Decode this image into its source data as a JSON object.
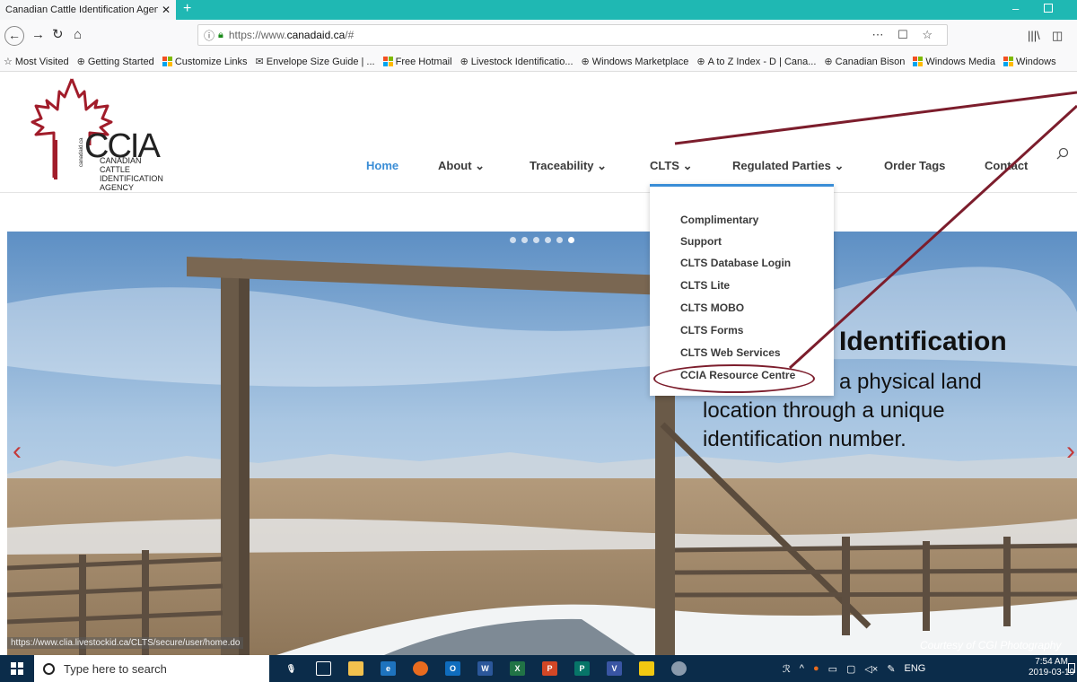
{
  "browser": {
    "tab_title": "Canadian Cattle Identification Agen",
    "url_scheme": "https://www.",
    "url_domain": "canadaid.ca",
    "url_path": "/#",
    "bookmarks": [
      {
        "label": "Most Visited",
        "icon": "star-icon"
      },
      {
        "label": "Getting Started",
        "icon": "globe-icon"
      },
      {
        "label": "Customize Links",
        "icon": "ms-icon"
      },
      {
        "label": "Envelope Size Guide | ...",
        "icon": "envelope-icon"
      },
      {
        "label": "Free Hotmail",
        "icon": "ms-icon"
      },
      {
        "label": "Livestock Identificatio...",
        "icon": "globe-icon"
      },
      {
        "label": "Windows Marketplace",
        "icon": "globe-icon"
      },
      {
        "label": "A to Z Index - D | Cana...",
        "icon": "globe-icon"
      },
      {
        "label": "Canadian Bison",
        "icon": "globe-icon"
      },
      {
        "label": "Windows Media",
        "icon": "ms-icon"
      },
      {
        "label": "Windows",
        "icon": "ms-icon"
      }
    ]
  },
  "site": {
    "logo": {
      "acronym": "CCIA",
      "name": "CANADIAN\nCATTLE\nIDENTIFICATION\nAGENCY",
      "domain": "canadaid.ca"
    },
    "nav": {
      "home": "Home",
      "about": "About",
      "traceability": "Traceability",
      "clts": "CLTS",
      "regulated": "Regulated Parties",
      "order": "Order Tags",
      "contact": "Contact"
    },
    "clts_menu": [
      "Complimentary",
      "Support",
      "CLTS Database Login",
      "CLTS Lite",
      "CLTS MOBO",
      "CLTS Forms",
      "CLTS Web Services",
      "CCIA Resource Centre"
    ],
    "hero": {
      "heading": "Identification",
      "body_line1": "g a physical land",
      "body_line2": "location through a unique",
      "body_line3": "identification number.",
      "credit": "Courtesy of CGI Photography",
      "slide_count": 6,
      "active_slide": 6
    },
    "status_url": "https://www.clia.livestockid.ca/CLTS/secure/user/home.do"
  },
  "taskbar": {
    "search_placeholder": "Type here to search",
    "language": "ENG",
    "time": "7:54 AM",
    "date": "2019-03-19"
  },
  "colors": {
    "titlebar": "#1fb8b3",
    "nav_active": "#3a8dd6",
    "annotation": "#7c1d2c",
    "taskbar": "#0b2c4a"
  }
}
